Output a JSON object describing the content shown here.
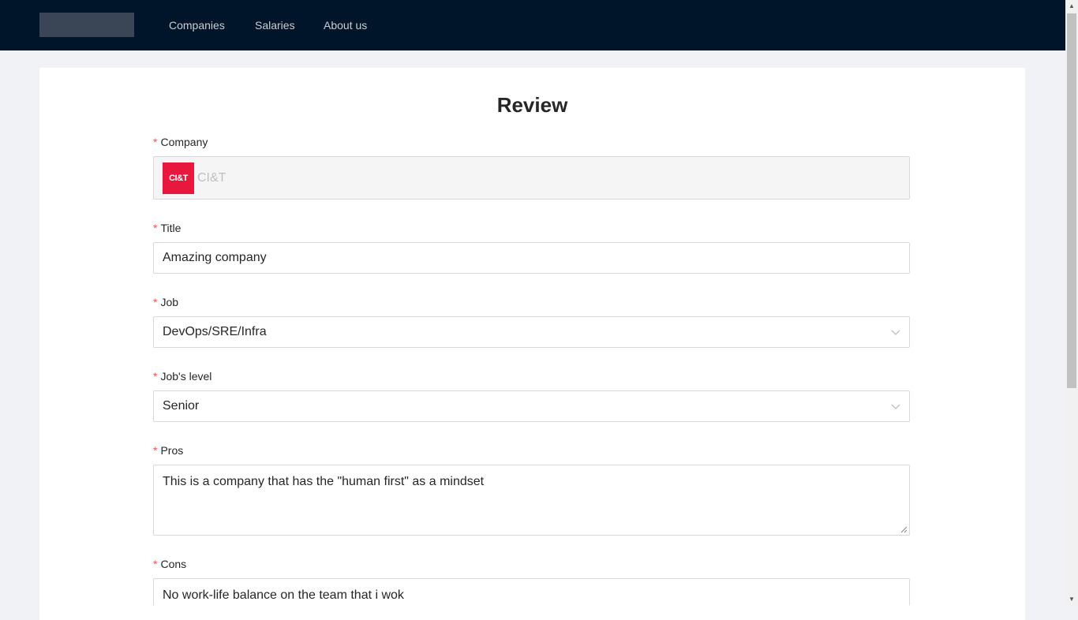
{
  "nav": {
    "items": [
      {
        "label": "Companies"
      },
      {
        "label": "Salaries"
      },
      {
        "label": "About us"
      }
    ]
  },
  "page": {
    "title": "Review"
  },
  "form": {
    "required_mark": "*",
    "company": {
      "label": "Company",
      "value": "CI&T",
      "logo_text": "CI&T",
      "logo_color": "#e8173d"
    },
    "title": {
      "label": "Title",
      "value": "Amazing company"
    },
    "job": {
      "label": "Job",
      "value": "DevOps/SRE/Infra",
      "icon": "chevron-down-icon"
    },
    "job_level": {
      "label": "Job's level",
      "value": "Senior",
      "icon": "chevron-down-icon"
    },
    "pros": {
      "label": "Pros",
      "value": "This is a company that has the \"human first\" as a mindset"
    },
    "cons": {
      "label": "Cons",
      "value": "No work-life balance on the team that i wok"
    }
  },
  "colors": {
    "header_bg": "#001529",
    "required": "#ff4d4f",
    "page_bg": "#f0f2f5"
  }
}
